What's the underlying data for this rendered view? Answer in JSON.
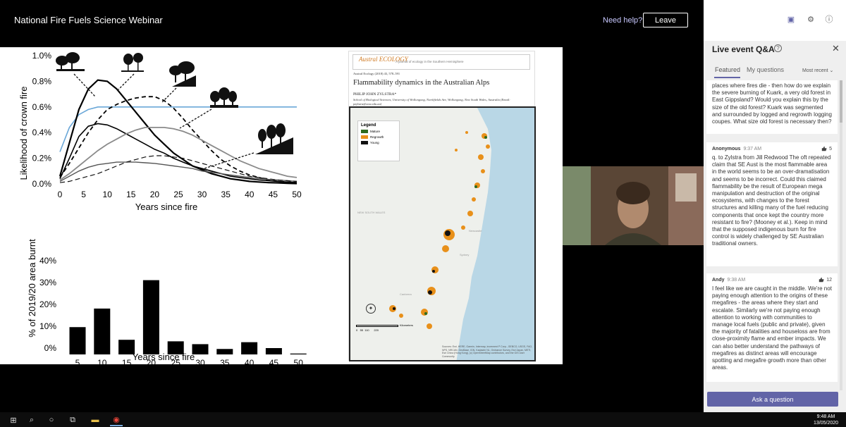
{
  "window": {
    "event_title": "National Fire Fuels Science Webinar",
    "need_help": "Need help?",
    "leave": "Leave"
  },
  "slide": {
    "top_chart": {
      "ylabel": "Likelihood of crown fire",
      "xlabel": "Years since fire",
      "y_ticks": [
        "1.0%",
        "0.8%",
        "0.6%",
        "0.4%",
        "0.2%",
        "0.0%"
      ],
      "x_ticks": [
        "0",
        "5",
        "10",
        "15",
        "20",
        "25",
        "30",
        "35",
        "40",
        "45",
        "50"
      ]
    },
    "bottom_chart": {
      "ylabel": "% of 2019/20 area burnt",
      "xlabel": "Years since fire",
      "y_ticks": [
        "40%",
        "30%",
        "20%",
        "10%",
        "0%"
      ],
      "x_ticks": [
        "5",
        "10",
        "15",
        "20",
        "25",
        "30",
        "35",
        "40",
        "45",
        "50"
      ]
    },
    "paper": {
      "journal_logo": "Austral ECOLOGY",
      "journal_tagline": "A journal of ecology in the Southern Hemisphere",
      "citation": "Austral Ecology (2018) 43, 578–591",
      "title": "Flammability dynamics in the Australian Alps",
      "author": "PHILIP JOHN ZYLSTRA*",
      "affiliation": "School of Biological Sciences, University of Wollongong, Northfields Ave, Wollongong, New South Wales, Australia (Email: pzylstra@uow.edu.au)",
      "map": {
        "legend_title": "Legend",
        "legend": [
          {
            "label": "Mature",
            "color": "#2e6b1f"
          },
          {
            "label": "Regrowth",
            "color": "#e8901a"
          },
          {
            "label": "Young",
            "color": "#111111"
          }
        ],
        "labels": {
          "state": "NEW SOUTH WALES",
          "city1": "Newcastle",
          "city2": "Sydney",
          "city3": "Canberra"
        },
        "scale_ticks": [
          "0",
          "55",
          "110",
          "220"
        ],
        "scale_unit": "Kilometers",
        "attribution": "Sources: Esri, HERE, Garmin, Intermap, increment P Corp., GEBCO, USGS, FAO, NPS, NRCAN, GeoBase, IGN, Kadaster NL, Ordnance Survey, Esri Japan, METI, Esri China (Hong Kong), (c) OpenStreetMap contributors, and the GIS User Community"
      }
    }
  },
  "qa_panel": {
    "title": "Live event Q&A",
    "tabs": [
      "Featured",
      "My questions"
    ],
    "sort": "Most recent",
    "questions": [
      {
        "author": "",
        "time": "",
        "likes": "",
        "text": "places where fires die - then how do we explain the severe burning of Kuark, a very old forest in East Gippsland? Would you explain this by the size of the old forest? Kuark was segmented and surrounded by logged and regrowth logging coupes. What size old forest is necessary then?"
      },
      {
        "author": "Anonymous",
        "time": "9:37 AM",
        "likes": "5",
        "text": "q. to Zylstra from Jill Redwood The oft repeated claim that SE Aust is the most flammable area in the world seems to be an over-dramatisation and seems to be incorrect. Could this claimed flammability be the result of European mega manipulation and destruction of the original ecosystems, with changes to the forest structures and killing many of the fuel reducing components that once kept the country more resistant to fire? (Mooney et al.). Keep in mind that the supposed indigenous burn for fire control is widely challenged by SE Australian traditional owners."
      },
      {
        "author": "Andy",
        "time": "9:38 AM",
        "likes": "12",
        "text": "I feel like we are caught in the middle. We're not paying enough attention to the origins of these megafires - the areas where they start and escalate. Similarly we're not paying enough attention to working with communities to manage local fuels (public and private), given the majority of fatalities and houseloss are from close-proximity flame and ember impacts. We can also better understand the pathways of megafires as distinct areas will encourage spotting and megafire growth more than other areas."
      }
    ],
    "ask_button": "Ask a question"
  },
  "taskbar": {
    "time": "9:48 AM",
    "date": "13/05/2020"
  },
  "chart_data": [
    {
      "type": "line",
      "title": "",
      "xlabel": "Years since fire",
      "ylabel": "Likelihood of crown fire",
      "xlim": [
        0,
        50
      ],
      "ylim": [
        0,
        1.0
      ],
      "y_unit": "%",
      "x": [
        0,
        2,
        4,
        6,
        8,
        10,
        12,
        14,
        16,
        18,
        20,
        22,
        24,
        26,
        28,
        30,
        32,
        34,
        36,
        38,
        40,
        42,
        44,
        46,
        48,
        50
      ],
      "series": [
        {
          "style": "solid-blue",
          "values": [
            0.25,
            0.44,
            0.54,
            0.58,
            0.6,
            0.6,
            0.6,
            0.6,
            0.6,
            0.6,
            0.6,
            0.6,
            0.6,
            0.6,
            0.6,
            0.6,
            0.6,
            0.6,
            0.6,
            0.6,
            0.6,
            0.6,
            0.6,
            0.6,
            0.6,
            0.6
          ]
        },
        {
          "style": "solid-black-thick",
          "values": [
            0.06,
            0.32,
            0.58,
            0.74,
            0.81,
            0.8,
            0.74,
            0.65,
            0.56,
            0.47,
            0.38,
            0.31,
            0.24,
            0.19,
            0.14,
            0.11,
            0.08,
            0.06,
            0.04,
            0.03,
            0.02,
            0.015,
            0.01,
            0.008,
            0.005,
            0.003
          ]
        },
        {
          "style": "solid-black",
          "values": [
            0.04,
            0.2,
            0.37,
            0.45,
            0.47,
            0.46,
            0.43,
            0.39,
            0.35,
            0.31,
            0.27,
            0.24,
            0.2,
            0.17,
            0.14,
            0.12,
            0.1,
            0.08,
            0.06,
            0.05,
            0.04,
            0.03,
            0.025,
            0.02,
            0.015,
            0.01
          ]
        },
        {
          "style": "dashed-black",
          "values": [
            0.05,
            0.16,
            0.28,
            0.4,
            0.5,
            0.58,
            0.62,
            0.65,
            0.67,
            0.68,
            0.68,
            0.65,
            0.59,
            0.51,
            0.42,
            0.34,
            0.26,
            0.19,
            0.14,
            0.1,
            0.07,
            0.05,
            0.03,
            0.02,
            0.015,
            0.01
          ]
        },
        {
          "style": "solid-gray",
          "values": [
            0.03,
            0.08,
            0.14,
            0.2,
            0.26,
            0.31,
            0.35,
            0.39,
            0.42,
            0.44,
            0.44,
            0.44,
            0.43,
            0.41,
            0.38,
            0.34,
            0.3,
            0.26,
            0.22,
            0.18,
            0.15,
            0.12,
            0.1,
            0.08,
            0.06,
            0.05
          ]
        },
        {
          "style": "solid-gray-2",
          "values": [
            0.02,
            0.06,
            0.1,
            0.13,
            0.15,
            0.16,
            0.17,
            0.17,
            0.17,
            0.165,
            0.16,
            0.15,
            0.14,
            0.13,
            0.12,
            0.1,
            0.09,
            0.08,
            0.07,
            0.06,
            0.05,
            0.04,
            0.035,
            0.03,
            0.025,
            0.02
          ]
        },
        {
          "style": "dashed-black-thin",
          "values": [
            0.01,
            0.02,
            0.04,
            0.06,
            0.08,
            0.11,
            0.14,
            0.17,
            0.19,
            0.21,
            0.22,
            0.22,
            0.21,
            0.2,
            0.18,
            0.16,
            0.14,
            0.12,
            0.1,
            0.08,
            0.06,
            0.05,
            0.04,
            0.03,
            0.025,
            0.02
          ]
        }
      ]
    },
    {
      "type": "bar",
      "title": "",
      "xlabel": "Years since fire",
      "ylabel": "% of 2019/20 area burnt",
      "ylim": [
        0,
        40
      ],
      "categories": [
        "5",
        "10",
        "15",
        "20",
        "25",
        "30",
        "35",
        "40",
        "45",
        "50"
      ],
      "values": [
        12.5,
        21,
        6.7,
        34,
        6,
        4.7,
        2.5,
        5.6,
        2.9,
        0.4
      ]
    }
  ]
}
